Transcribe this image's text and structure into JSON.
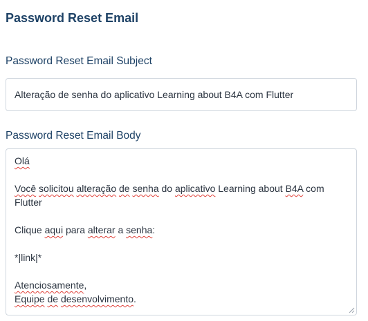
{
  "section": {
    "title": "Password Reset Email"
  },
  "subject": {
    "label": "Password Reset Email Subject",
    "value": "Alteração de senha do aplicativo Learning about B4A com Flutter"
  },
  "body": {
    "label": "Password Reset Email Body",
    "greeting": "Olá",
    "line1": {
      "w1": "Você",
      "w2": "solicitou",
      "w3": "alteração",
      "w4": "de",
      "w5": "senha",
      "t1": "do",
      "w6": "aplicativo",
      "t2": "Learning about",
      "w7": "B4A",
      "t3": "com Flutter"
    },
    "line2": {
      "t1": "Clique",
      "w1": "aqui",
      "t2": "para",
      "w2": "alterar",
      "t3": "a",
      "w3": "senha",
      "t4": ":"
    },
    "link_token": "*|link|*",
    "closing": "Atenciosamente",
    "closing_punct": ",",
    "signature": {
      "w1": "Equipe",
      "w2": "de",
      "w3": "desenvolvimento",
      "punct": "."
    }
  }
}
